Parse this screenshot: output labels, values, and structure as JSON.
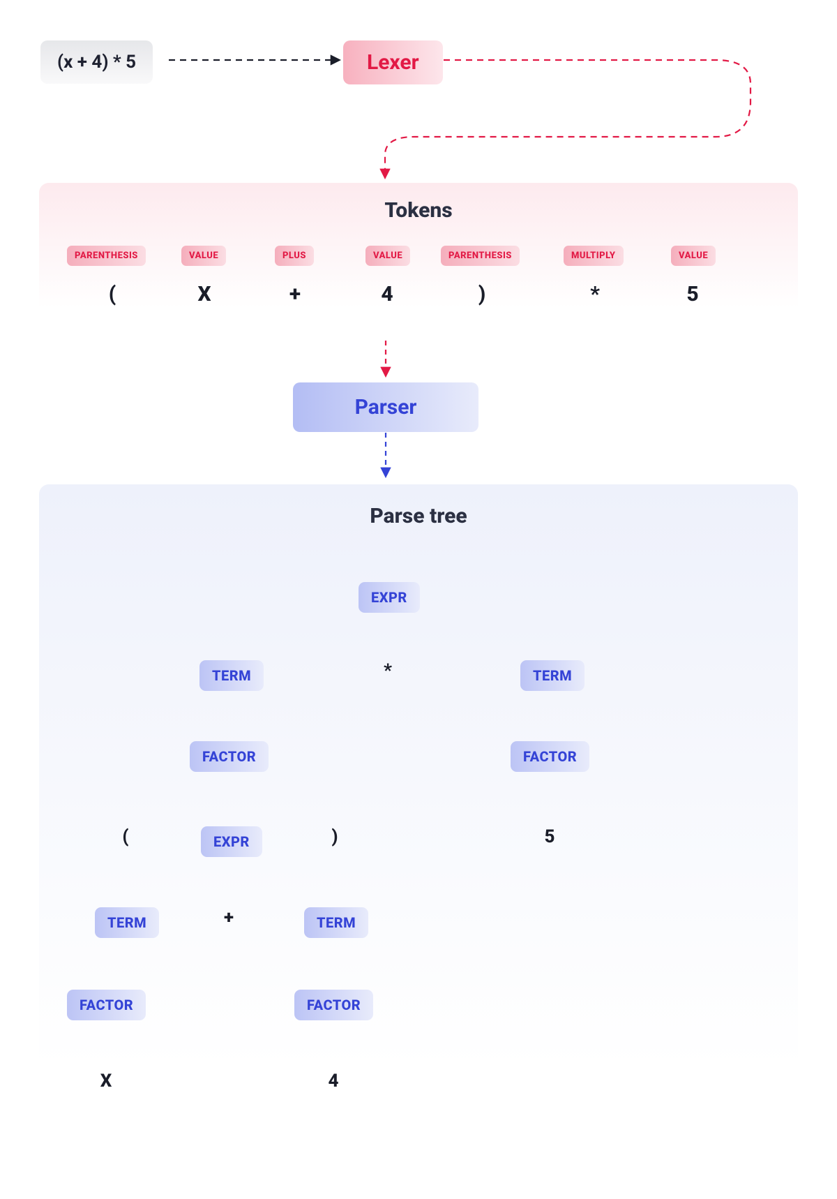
{
  "source_expression": "(x + 4) * 5",
  "stages": {
    "lexer": "Lexer",
    "parser": "Parser"
  },
  "tokens_panel_title": "Tokens",
  "tokens": [
    {
      "type": "PARENTHESIS",
      "value": "("
    },
    {
      "type": "VALUE",
      "value": "X"
    },
    {
      "type": "PLUS",
      "value": "+"
    },
    {
      "type": "VALUE",
      "value": "4"
    },
    {
      "type": "PARENTHESIS",
      "value": ")"
    },
    {
      "type": "MULTIPLY",
      "value": "*"
    },
    {
      "type": "VALUE",
      "value": "5"
    }
  ],
  "parse_tree_title": "Parse tree",
  "node_labels": {
    "expr": "EXPR",
    "term": "TERM",
    "factor": "FACTOR"
  },
  "leaves": {
    "star": "*",
    "lparen": "(",
    "rparen": ")",
    "plus": "+",
    "five": "5",
    "x": "X",
    "four": "4"
  },
  "chart_data": {
    "type": "tree",
    "title": "Parse tree",
    "root": {
      "label": "EXPR",
      "children": [
        {
          "label": "TERM",
          "children": [
            {
              "label": "FACTOR",
              "children": [
                {
                  "label": "("
                },
                {
                  "label": "EXPR",
                  "children": [
                    {
                      "label": "TERM",
                      "children": [
                        {
                          "label": "FACTOR",
                          "children": [
                            {
                              "label": "X"
                            }
                          ]
                        }
                      ]
                    },
                    {
                      "label": "+"
                    },
                    {
                      "label": "TERM",
                      "children": [
                        {
                          "label": "FACTOR",
                          "children": [
                            {
                              "label": "4"
                            }
                          ]
                        }
                      ]
                    }
                  ]
                },
                {
                  "label": ")"
                }
              ]
            }
          ]
        },
        {
          "label": "*"
        },
        {
          "label": "TERM",
          "children": [
            {
              "label": "FACTOR",
              "children": [
                {
                  "label": "5"
                }
              ]
            }
          ]
        }
      ]
    }
  }
}
